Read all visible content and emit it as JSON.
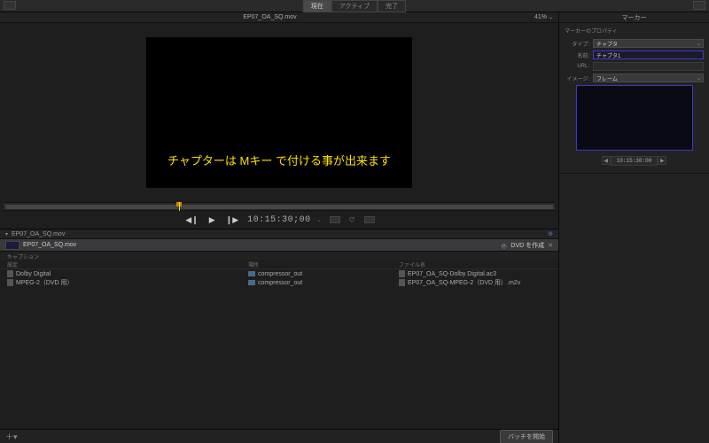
{
  "topbar": {
    "tabs": [
      {
        "label": "現在",
        "active": true
      },
      {
        "label": "アクティブ",
        "active": false
      },
      {
        "label": "完了",
        "active": false
      }
    ]
  },
  "viewer": {
    "title": "EP07_OA_SQ.mov",
    "zoom": "41%",
    "overlay": "チャプターは Mキー で付ける事が出来ます"
  },
  "transport": {
    "timecode": "10:15:30;00"
  },
  "batch": {
    "header_name": "EP07_OA_SQ.mov",
    "job": {
      "name": "EP07_OA_SQ.mov",
      "action_label": "DVD を作成"
    },
    "caption_label": "キャプション",
    "table": {
      "col1": "設定",
      "col2": "場所",
      "col3": "ファイル名",
      "rows": [
        {
          "setting": "Dolby Digital",
          "location": "compressor_out",
          "filename": "EP07_OA_SQ-Dolby Digital.ac3"
        },
        {
          "setting": "MPEG-2（DVD 用）",
          "location": "compressor_out",
          "filename": "EP07_OA_SQ-MPEG-2（DVD 用）.m2v"
        }
      ]
    }
  },
  "bottom": {
    "start_label": "バッチを開始"
  },
  "inspector": {
    "title": "マーカー",
    "properties_label": "マーカーのプロパティ",
    "type_label": "タイプ:",
    "type_value": "チャプタ",
    "name_label": "名前:",
    "name_value": "チャプタ1",
    "url_label": "URL:",
    "url_value": "",
    "image_label": "イメージ:",
    "image_value": "フレーム",
    "timecode": "10:15:30:00"
  }
}
